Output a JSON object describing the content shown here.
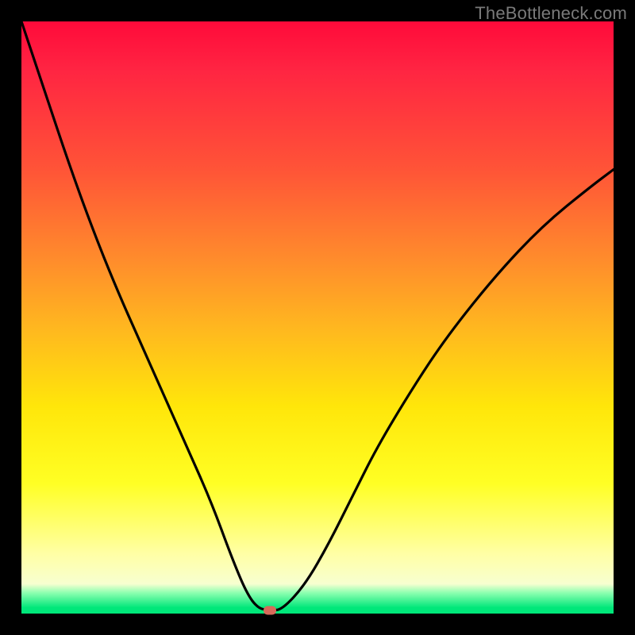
{
  "watermark": "TheBottleneck.com",
  "gradient_colors": {
    "top": "#ff0a3a",
    "mid_orange": "#ff8b2c",
    "yellow": "#ffe60a",
    "pale": "#ffffa6",
    "green": "#00e77a"
  },
  "chart_data": {
    "type": "line",
    "title": "",
    "xlabel": "",
    "ylabel": "",
    "xlim": [
      0,
      100
    ],
    "ylim": [
      0,
      100
    ],
    "series": [
      {
        "name": "bottleneck-curve",
        "x": [
          0,
          4,
          8,
          12,
          16,
          20,
          24,
          28,
          32,
          35.5,
          38,
          40,
          42,
          44,
          48,
          52,
          56,
          60,
          66,
          72,
          80,
          88,
          96,
          100
        ],
        "values": [
          100,
          88,
          76,
          65,
          55,
          46,
          37,
          28,
          19,
          9.5,
          3.5,
          0.8,
          0.6,
          0.6,
          5,
          12,
          20,
          28,
          38,
          47,
          57,
          65.5,
          72,
          75
        ]
      }
    ],
    "marker": {
      "x": 42,
      "y": 0.6,
      "color": "#d76a5a"
    },
    "grid": false,
    "legend": false
  }
}
